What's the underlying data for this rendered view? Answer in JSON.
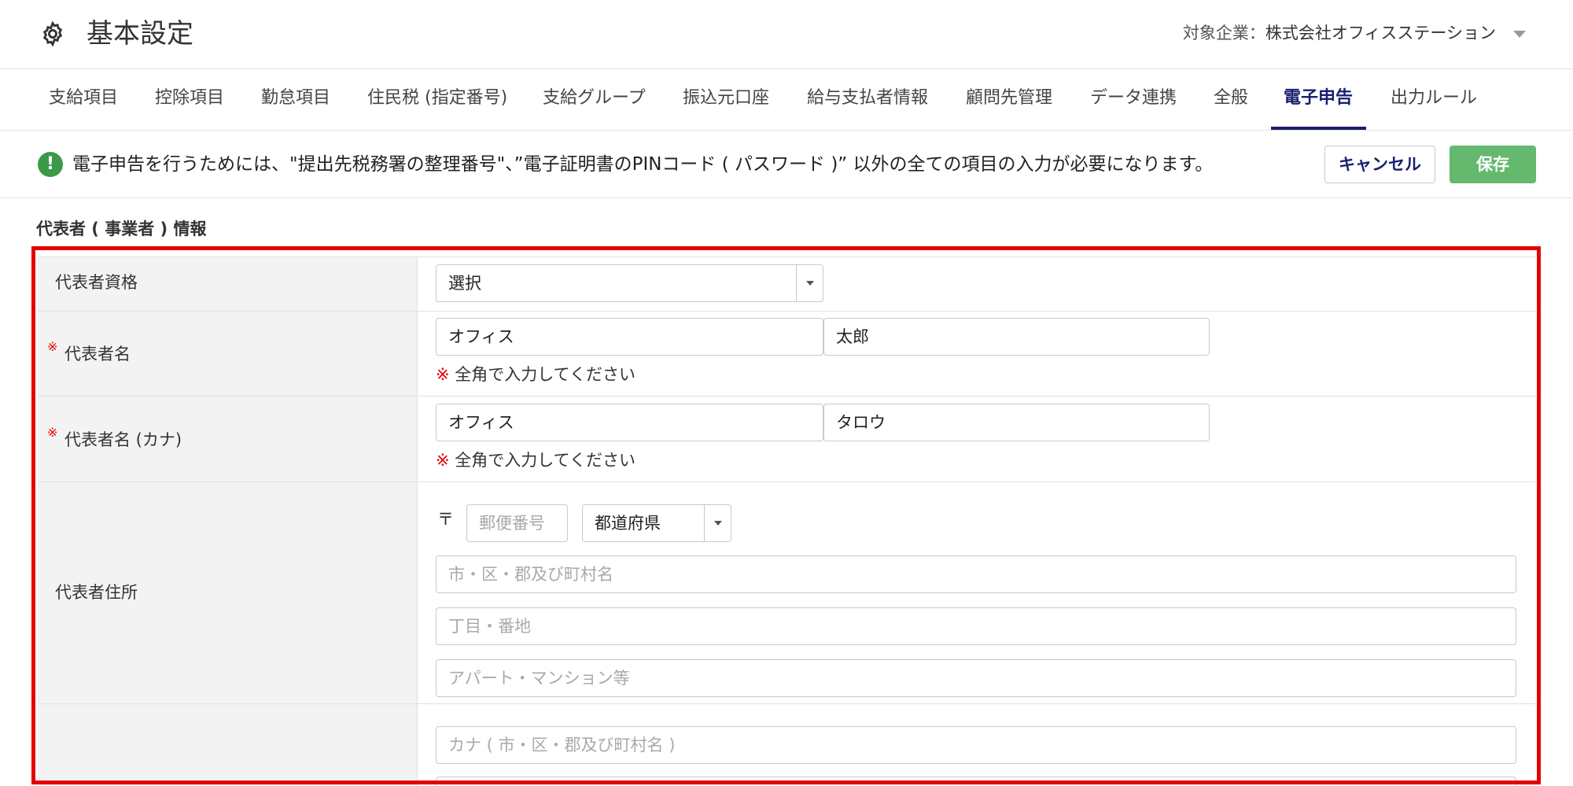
{
  "header": {
    "title": "基本設定",
    "company_label": "対象企業：",
    "company_name": "株式会社オフィスステーション"
  },
  "tabs": [
    {
      "label": "支給項目"
    },
    {
      "label": "控除項目"
    },
    {
      "label": "勤怠項目"
    },
    {
      "label": "住民税 (指定番号)"
    },
    {
      "label": "支給グループ"
    },
    {
      "label": "振込元口座"
    },
    {
      "label": "給与支払者情報"
    },
    {
      "label": "顧問先管理"
    },
    {
      "label": "データ連携"
    },
    {
      "label": "全般"
    },
    {
      "label": "電子申告",
      "active": true
    },
    {
      "label": "出力ルール"
    }
  ],
  "notice": {
    "icon": "exclamation-icon",
    "text": "電子申告を行うためには、\"提出先税務署の整理番号\"、”電子証明書のPINコード ( パスワード )” 以外の全ての項目の入力が必要になります。"
  },
  "actions": {
    "cancel_label": "キャンセル",
    "save_label": "保存"
  },
  "section": {
    "title": "代表者 ( 事業者 ) 情報"
  },
  "form": {
    "qualification": {
      "label": "代表者資格",
      "selected": "選択"
    },
    "name": {
      "label": "代表者名",
      "required_mark": "※",
      "last": "オフィス",
      "first": "太郎",
      "hint_mark": "※",
      "hint": "全角で入力してください"
    },
    "name_kana": {
      "label": "代表者名 (カナ)",
      "required_mark": "※",
      "last": "オフィス",
      "first": "タロウ",
      "hint_mark": "※",
      "hint": "全角で入力してください"
    },
    "address": {
      "label": "代表者住所",
      "postal_mark": "〒",
      "postal_placeholder": "郵便番号",
      "prefecture_selected": "都道府県",
      "city_placeholder": "市・区・郡及び町村名",
      "block_placeholder": "丁目・番地",
      "building_placeholder": "アパート・マンション等"
    },
    "address_kana": {
      "city_placeholder": "カナ ( 市・区・郡及び町村名 )"
    }
  },
  "colors": {
    "accent_navy": "#1a1f6e",
    "save_green": "#64b96e",
    "notice_green": "#3a9a48",
    "required_red": "#e30000",
    "highlight_frame": "#e30000"
  }
}
